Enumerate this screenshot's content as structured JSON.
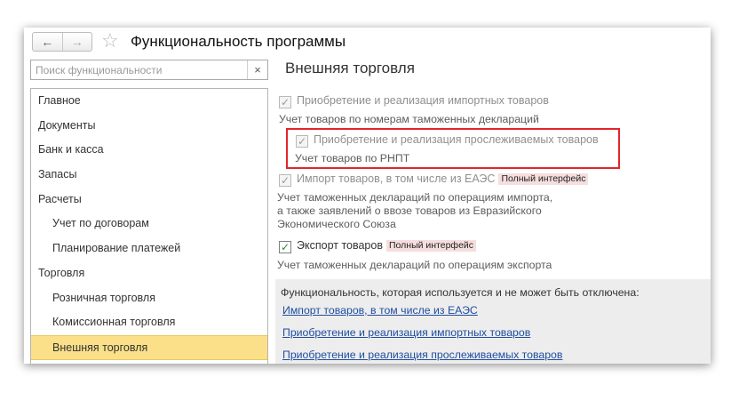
{
  "window": {
    "title": "Функциональность программы",
    "back_icon": "←",
    "forward_icon": "→",
    "star_icon": "☆"
  },
  "search": {
    "placeholder": "Поиск функциональности",
    "clear_icon": "×"
  },
  "sidebar": {
    "items": [
      {
        "label": "Главное",
        "level": 0
      },
      {
        "label": "Документы",
        "level": 0
      },
      {
        "label": "Банк и касса",
        "level": 0
      },
      {
        "label": "Запасы",
        "level": 0
      },
      {
        "label": "Расчеты",
        "level": 0
      },
      {
        "label": "Учет по договорам",
        "level": 1
      },
      {
        "label": "Планирование платежей",
        "level": 1
      },
      {
        "label": "Торговля",
        "level": 0
      },
      {
        "label": "Розничная торговля",
        "level": 1
      },
      {
        "label": "Комиссионная торговля",
        "level": 1
      },
      {
        "label": "Внешняя торговля",
        "level": 1,
        "selected": true
      }
    ]
  },
  "main": {
    "section_title": "Внешняя торговля",
    "options": {
      "import_goods": {
        "label": "Приобретение и реализация импортных товаров",
        "checked": true,
        "enabled": false,
        "description": "Учет товаров по номерам таможенных деклараций"
      },
      "traceable_goods": {
        "label": "Приобретение и реализация прослеживаемых товаров",
        "checked": true,
        "enabled": false,
        "description": "Учет товаров по РНПТ"
      },
      "import_eaeu": {
        "label": "Импорт товаров, в том числе из ЕАЭС",
        "badge": "Полный интерфейс",
        "checked": true,
        "enabled": false,
        "description": "Учет таможенных деклараций по операциям импорта, а также заявлений о ввозе товаров из Евразийского Экономического Союза"
      },
      "export_goods": {
        "label": "Экспорт товаров",
        "badge": "Полный интерфейс",
        "checked": true,
        "enabled": true,
        "description": "Учет таможенных деклараций по операциям экспорта"
      }
    },
    "footer": {
      "heading": "Функциональность, которая используется и не может быть отключена:",
      "links": [
        "Импорт товаров, в том числе из ЕАЭС",
        "Приобретение и реализация импортных товаров",
        "Приобретение и реализация прослеживаемых товаров"
      ]
    },
    "check_mark": "✓"
  },
  "colors": {
    "selected_item": "#fbe089",
    "highlight_border": "#e2252b",
    "link": "#1f4ea1",
    "badge_bg": "#f6dede",
    "check_enabled": "#2c8a2c"
  }
}
